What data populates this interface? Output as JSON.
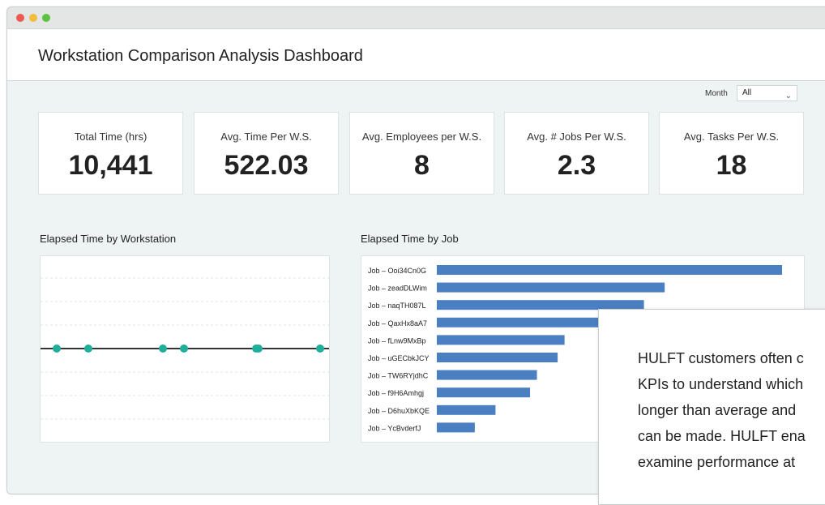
{
  "header": {
    "title": "Workstation Comparison Analysis Dashboard"
  },
  "filter": {
    "label": "Month",
    "value": "All"
  },
  "kpis": [
    {
      "label": "Total Time (hrs)",
      "value": "10,441"
    },
    {
      "label": "Avg. Time Per W.S.",
      "value": "522.03"
    },
    {
      "label": "Avg. Employees per W.S.",
      "value": "8"
    },
    {
      "label": "Avg. # Jobs Per W.S.",
      "value": "2.3"
    },
    {
      "label": "Avg. Tasks Per W.S.",
      "value": "18"
    }
  ],
  "charts": {
    "left_title": "Elapsed Time by Workstation",
    "right_title": "Elapsed Time by Job"
  },
  "overlay": {
    "lines": [
      "HULFT customers often c",
      "KPIs to understand which",
      "longer than average and",
      "can be made. HULFT ena",
      "examine performance at"
    ]
  },
  "colors": {
    "bar": "#4a7fc1",
    "dot": "#1fae9b",
    "accent_line": "#333333"
  },
  "chart_data": [
    {
      "type": "line",
      "title": "Elapsed Time by Workstation",
      "series": [
        {
          "values": [
            0,
            0,
            0,
            0,
            0,
            0,
            0
          ]
        }
      ],
      "x": [
        1,
        2,
        3,
        4,
        5,
        6,
        7
      ],
      "grid": true
    },
    {
      "type": "bar",
      "orientation": "horizontal",
      "title": "Elapsed Time by Job",
      "categories": [
        "Job – Ooi34Cn0G",
        "Job – zeadDLWim",
        "Job – naqTH087L",
        "Job – QaxHx8aA7",
        "Job – fLnw9MxBp",
        "Job – uGECbkJCY",
        "Job – TW6RYjdhC",
        "Job – f9H6Amhgj",
        "Job – D6huXbKQE",
        "Job – YcBvderfJ"
      ],
      "values": [
        100,
        66,
        60,
        50,
        37,
        35,
        29,
        27,
        17,
        11
      ],
      "xlim": [
        0,
        100
      ]
    }
  ]
}
